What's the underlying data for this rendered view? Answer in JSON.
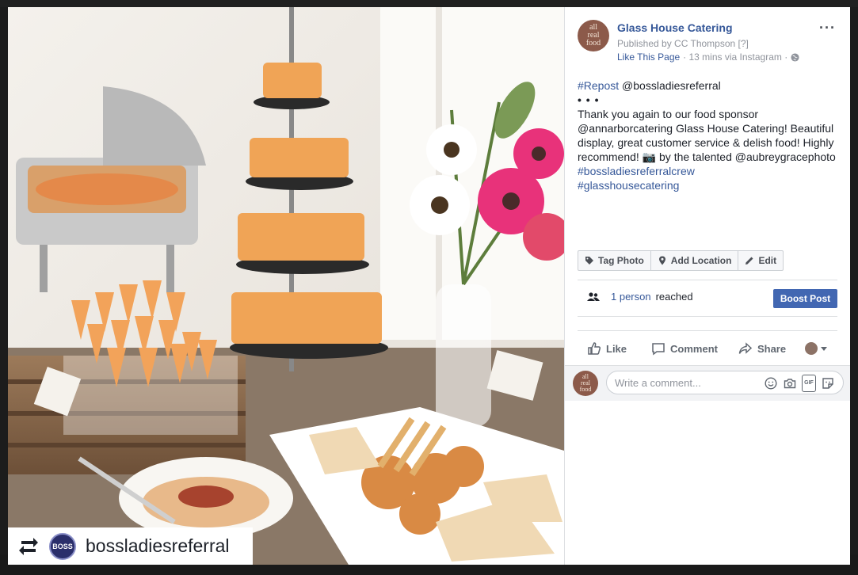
{
  "photo": {
    "repost_handle": "bossladiesreferral",
    "repost_avatar_text": "BOSS"
  },
  "post": {
    "page_name": "Glass House Catering",
    "page_avatar_lines": [
      "all",
      "real",
      "food"
    ],
    "published_by": "Published by CC Thompson [?]",
    "like_page": "Like This Page",
    "meta": "· 13 mins via Instagram ·",
    "more": "···",
    "body": {
      "repost_tag": "#Repost",
      "repost_handle": " @bossladiesreferral",
      "dots": "• • •",
      "line1": "Thank you again to our food sponsor",
      "line2": "@annarborcatering Glass House Catering! Beautiful",
      "line3": "display, great customer service & delish food! Highly",
      "line4": "recommend! 📷 by the talented @aubreygracephoto",
      "tag1": "#bossladiesreferralcrew",
      "tag2": "#glasshousecatering"
    },
    "photo_actions": {
      "tag_photo": "Tag Photo",
      "add_location": "Add Location",
      "edit": "Edit"
    },
    "reach": {
      "count_link": "1 person",
      "suffix": "reached"
    },
    "boost": "Boost Post",
    "engage": {
      "like": "Like",
      "comment": "Comment",
      "share": "Share"
    },
    "comment_placeholder": "Write a comment..."
  },
  "colors": {
    "link": "#365899",
    "boost": "#4267b2",
    "text": "#1d2129",
    "muted": "#90949c"
  }
}
